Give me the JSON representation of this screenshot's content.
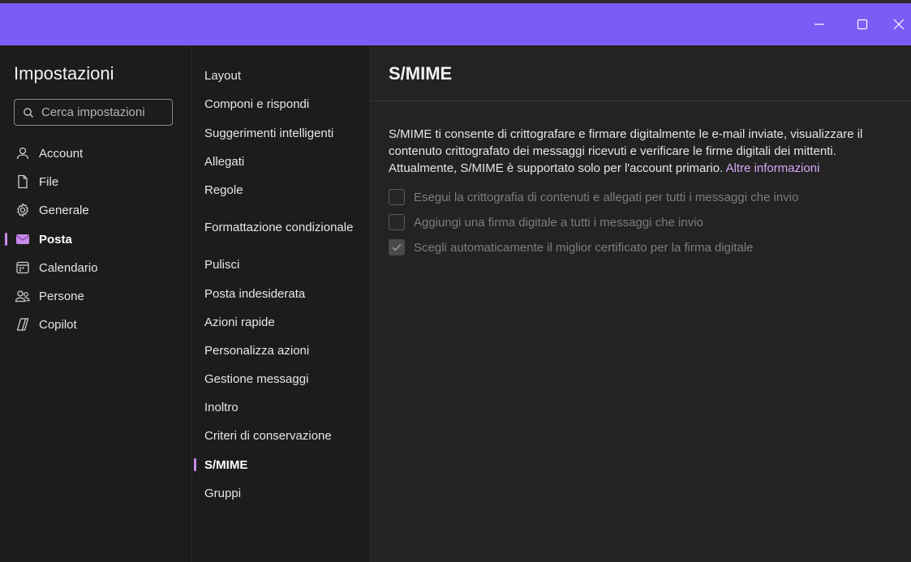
{
  "window": {
    "controls": {
      "minimize": "minimize-icon",
      "maximize": "maximize-icon",
      "close": "close-icon"
    },
    "accent": "#7b5cf5"
  },
  "sidebar": {
    "title": "Impostazioni",
    "search_placeholder": "Cerca impostazioni",
    "items": [
      {
        "label": "Account",
        "icon": "person-icon"
      },
      {
        "label": "File",
        "icon": "file-icon"
      },
      {
        "label": "Generale",
        "icon": "gear-icon"
      },
      {
        "label": "Posta",
        "icon": "mail-icon",
        "active": true
      },
      {
        "label": "Calendario",
        "icon": "calendar-icon"
      },
      {
        "label": "Persone",
        "icon": "people-icon"
      },
      {
        "label": "Copilot",
        "icon": "copilot-icon"
      }
    ]
  },
  "subnav": {
    "items": [
      "Layout",
      "Componi e rispondi",
      "Suggerimenti intelligenti",
      "Allegati",
      "Regole",
      "Formattazione condizionale",
      "Pulisci",
      "Posta indesiderata",
      "Azioni rapide",
      "Personalizza azioni",
      "Gestione messaggi",
      "Inoltro",
      "Criteri di conservazione",
      "S/MIME",
      "Gruppi"
    ],
    "active": "S/MIME"
  },
  "main": {
    "title": "S/MIME",
    "description": "S/MIME ti consente di crittografare e firmare digitalmente le e-mail inviate, visualizzare il contenuto crittografato dei messaggi ricevuti e verificare le firme digitali dei mittenti. Attualmente, S/MIME è supportato solo per l'account primario.",
    "more_info_link": "Altre informazioni",
    "options": [
      {
        "label": "Esegui la crittografia di contenuti e allegati per tutti i messaggi che invio",
        "checked": false
      },
      {
        "label": "Aggiungi una firma digitale a tutti i messaggi che invio",
        "checked": false
      },
      {
        "label": "Scegli automaticamente il miglior certificato per la firma digitale",
        "checked": true
      }
    ]
  },
  "colors": {
    "titlebar": "#7b5cf5",
    "active_indicator": "#c88be8",
    "link": "#d8a6f5",
    "background": "#1c1c1c"
  }
}
